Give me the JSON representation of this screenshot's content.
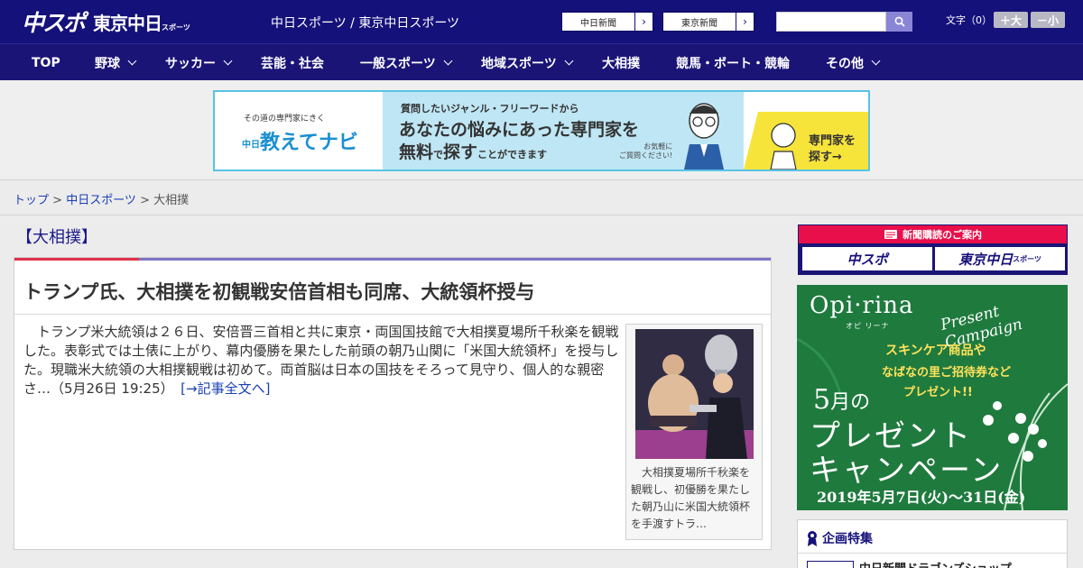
{
  "header": {
    "logo_main": "中スポ",
    "logo_sub": "東京中日",
    "logo_sub_small": "スポーツ",
    "site_title": "中日スポーツ / 東京中日スポーツ",
    "links": [
      {
        "label": "中日新聞"
      },
      {
        "label": "東京新聞"
      }
    ],
    "search_placeholder": "",
    "font_size_label": "文字（0）",
    "font_up": "＋大",
    "font_down": "－小"
  },
  "nav": {
    "items": [
      {
        "label": "TOP",
        "dropdown": false
      },
      {
        "label": "野球",
        "dropdown": true
      },
      {
        "label": "サッカー",
        "dropdown": true
      },
      {
        "label": "芸能・社会",
        "dropdown": false
      },
      {
        "label": "一般スポーツ",
        "dropdown": true
      },
      {
        "label": "地域スポーツ",
        "dropdown": true
      },
      {
        "label": "大相撲",
        "dropdown": false
      },
      {
        "label": "競馬・ボート・競輪",
        "dropdown": false
      },
      {
        "label": "その他",
        "dropdown": true
      }
    ]
  },
  "ad_banner": {
    "left_small": "その道の専門家にきく",
    "left_title": "教えてナビ",
    "left_badge": "中日",
    "mid_line1": "質問したいジャンル・フリーワードから",
    "mid_line2": "あなたの悩みにあった専門家を",
    "mid_line3a": "無料",
    "mid_line3b": "で",
    "mid_line3c": "探す",
    "mid_line3d": "ことができます",
    "mid_note1": "お気軽に",
    "mid_note2": "ご質問ください!",
    "right_text1": "専門家を",
    "right_text2": "探す→"
  },
  "breadcrumb": {
    "items": [
      "トップ",
      "中日スポーツ",
      "大相撲"
    ],
    "sep": " > "
  },
  "article": {
    "category": "【大相撲】",
    "headline": "トランプ氏、大相撲を初観戦安倍首相も同席、大統領杯授与",
    "lead": "トランプ米大統領は２６日、安倍晋三首相と共に東京・両国国技館で大相撲夏場所千秋楽を観戦した。表彰式では土俵に上がり、幕内優勝を果たした前頭の朝乃山関に「米国大統領杯」を授与した。現職米大統領の大相撲観戦は初めて。両首脳は日本の国技をそろって見守り、個人的な親密さ…（5月26日 19:25）",
    "read_more": "[→記事全文へ]",
    "caption": "大相撲夏場所千秋楽を観戦し、初優勝を果たした朝乃山に米国大統領杯を手渡すトラ…"
  },
  "sidebar": {
    "subscribe_head": "新聞購読のご案内",
    "subscribe_btn1": "中スポ",
    "subscribe_btn2": "東京中日",
    "subscribe_btn2_small": "スポーツ",
    "promo": {
      "brand": "Opi·rina",
      "brand_small": "オピ リーナ",
      "campaign": "Present Campaign",
      "line1": "スキンケア商品や",
      "line2": "なばなの里ご招待券など",
      "line3": "プレゼント!!",
      "big1a": "5",
      "big1b": "月の",
      "big2": "プレゼント",
      "big3": "キャンペーン",
      "date": "2019年5月7日(火)〜31日(金)"
    },
    "feature_head": "企画特集",
    "feature_item": "中日新聞ドラゴンズショップ"
  },
  "colors": {
    "header_bg": "#15117a",
    "nav_bg": "#1b1477",
    "accent_red": "#e0314c",
    "link": "#1a3fb6",
    "promo_green": "#1f7a3e"
  }
}
